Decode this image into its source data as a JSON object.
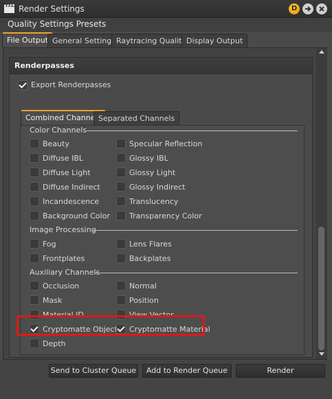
{
  "window": {
    "title": "Render Settings",
    "menu_title": "Quality Settings Presets"
  },
  "titlebar_buttons": {
    "d_label": "D"
  },
  "tabs": [
    {
      "label": "File Output",
      "active": true
    },
    {
      "label": "General Settings"
    },
    {
      "label": "Raytracing Quality"
    },
    {
      "label": "Display Output"
    }
  ],
  "renderpasses": {
    "title": "Renderpasses",
    "export_label": "Export Renderpasses",
    "export_checked": true,
    "subtabs": [
      {
        "label": "Combined Channels",
        "active": true
      },
      {
        "label": "Separated Channels"
      }
    ],
    "sections": {
      "color": "Color Channels",
      "image": "Image Processing",
      "aux": "Auxiliary Channels"
    },
    "color_channels": {
      "left": [
        "Beauty",
        "Diffuse IBL",
        "Diffuse Light",
        "Diffuse Indirect",
        "Incandescence",
        "Background Color"
      ],
      "right": [
        "Specular Reflection",
        "Glossy IBL",
        "Glossy Light",
        "Glossy Indirect",
        "Translucency",
        "Transparency Color"
      ]
    },
    "image_processing": {
      "left": [
        "Fog",
        "Frontplates"
      ],
      "right": [
        "Lens Flares",
        "Backplates"
      ]
    },
    "aux_channels": {
      "left": [
        "Occlusion",
        "Mask",
        "Material ID",
        "Cryptomatte Object",
        "Depth"
      ],
      "right": [
        "Normal",
        "Position",
        "View Vector",
        "Cryptomatte Material"
      ],
      "checked": [
        "Cryptomatte Object",
        "Cryptomatte Material"
      ]
    }
  },
  "footer": {
    "send_cluster": "Send to Cluster Queue",
    "add_render_queue": "Add to Render Queue",
    "render": "Render"
  },
  "colors": {
    "accent": "#f0a030",
    "highlight": "#e01818"
  }
}
